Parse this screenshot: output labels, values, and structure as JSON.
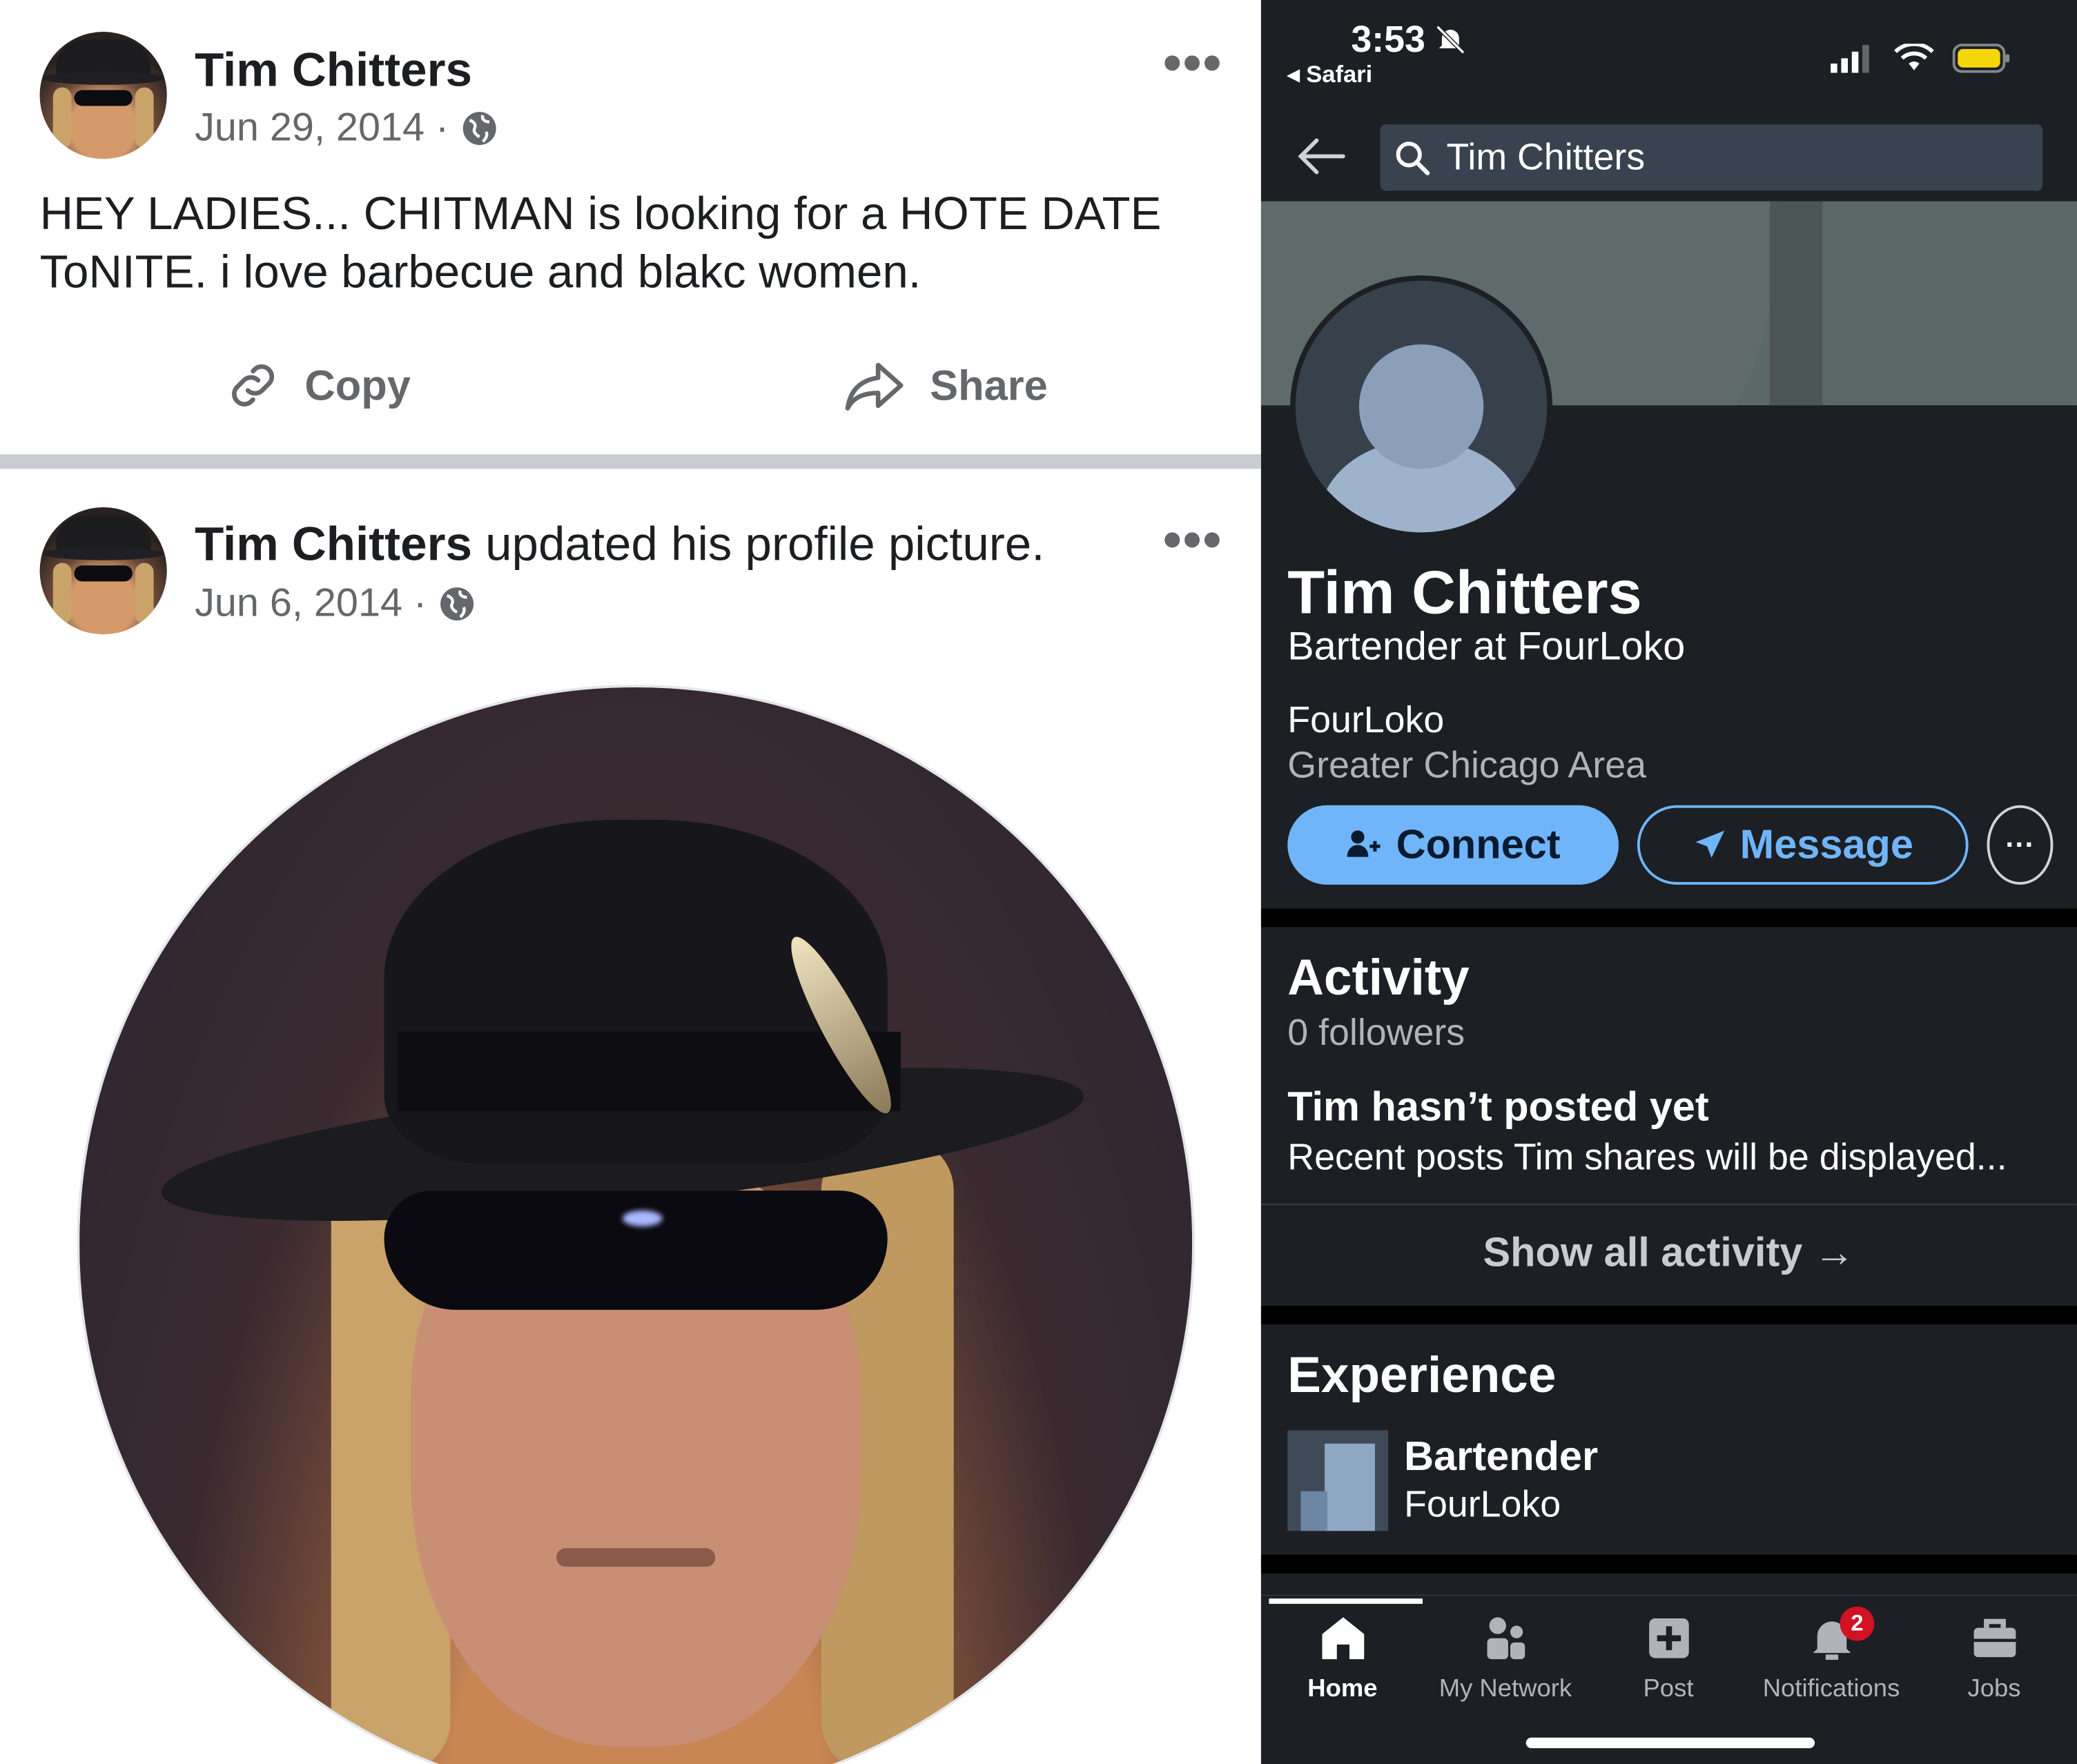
{
  "facebook": {
    "post1": {
      "author": "Tim Chitters",
      "date": "Jun 29, 2014 ·",
      "text_line1": "HEY LADIES... CHITMAN is looking for a HOTE DATE",
      "text_line2": "ToNITE. i love barbecue and blakc women.",
      "copy_label": "Copy",
      "share_label": "Share"
    },
    "post2": {
      "author": "Tim Chitters",
      "action": "updated his profile picture.",
      "date": "Jun 6, 2014 ·"
    },
    "more_label": "•••"
  },
  "linkedin": {
    "status": {
      "time": "3:53",
      "back_app": "◂ Safari"
    },
    "search": {
      "query": "Tim Chitters"
    },
    "profile": {
      "name": "Tim Chitters",
      "headline": "Bartender at FourLoko",
      "company": "FourLoko",
      "location": "Greater Chicago Area"
    },
    "buttons": {
      "connect": "Connect",
      "message": "Message",
      "more": "···"
    },
    "activity": {
      "title": "Activity",
      "followers": "0 followers",
      "empty_title": "Tim hasn’t posted yet",
      "empty_text": "Recent posts Tim shares will be displayed...",
      "show_all": "Show all activity →"
    },
    "experience": {
      "title": "Experience",
      "role": "Bartender",
      "company": "FourLoko"
    },
    "tabs": [
      {
        "label": "Home",
        "icon": "home-icon"
      },
      {
        "label": "My Network",
        "icon": "network-icon"
      },
      {
        "label": "Post",
        "icon": "post-icon"
      },
      {
        "label": "Notifications",
        "icon": "bell-icon",
        "badge": "2"
      },
      {
        "label": "Jobs",
        "icon": "briefcase-icon"
      }
    ],
    "accent_color": "#70b5f9",
    "badge_color": "#d11124"
  }
}
